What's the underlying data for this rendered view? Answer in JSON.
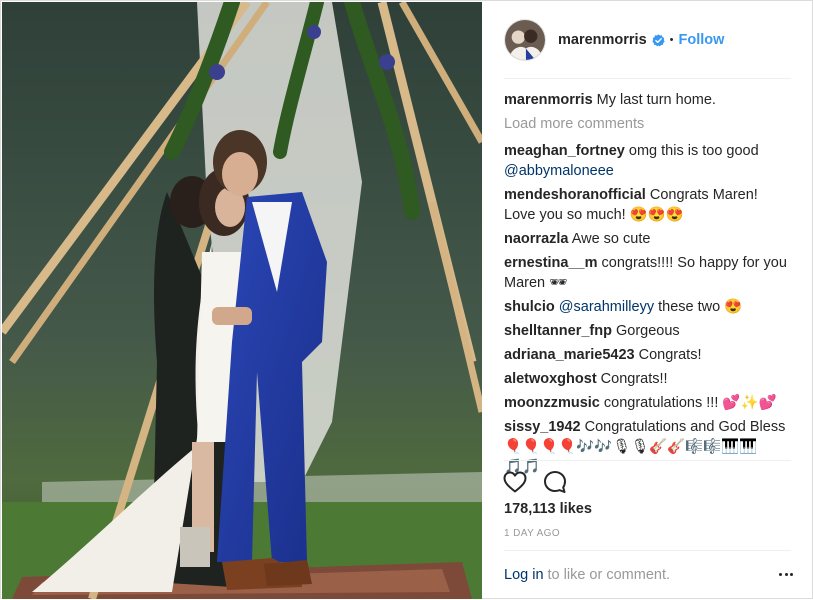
{
  "post": {
    "owner": "marenmorris",
    "follow_label": "Follow",
    "dot": "•",
    "caption": {
      "user": "marenmorris",
      "text": " My last turn home."
    },
    "load_more": "Load more comments",
    "comments": [
      {
        "user": "meaghan_fortney",
        "text": " omg this is too good ",
        "mention": "@abbymaloneee",
        "after": ""
      },
      {
        "user": "mendeshoranofficial",
        "text": " Congrats Maren! Love you so much! 😍😍😍",
        "mention": "",
        "after": ""
      },
      {
        "user": "naorrazla",
        "text": " Awe so cute",
        "mention": "",
        "after": ""
      },
      {
        "user": "ernestina__m",
        "text": " congrats!!!! So happy for you Maren 🕶",
        "mention": "",
        "after": ""
      },
      {
        "user": "shulcio",
        "text": " ",
        "mention": "@sarahmilleyy",
        "after": " these two 😍"
      },
      {
        "user": "shelltanner_fnp",
        "text": " Gorgeous",
        "mention": "",
        "after": ""
      },
      {
        "user": "adriana_marie5423",
        "text": " Congrats!",
        "mention": "",
        "after": ""
      },
      {
        "user": "aletwoxghost",
        "text": " Congrats!!",
        "mention": "",
        "after": ""
      },
      {
        "user": "moonzzmusic",
        "text": " congratulations !!! 💕✨💕",
        "mention": "",
        "after": ""
      },
      {
        "user": "sissy_1942",
        "text": " Congratulations and God Bless 🎈🎈🎈🎈🎶🎶🎙🎙🎸🎸🎼🎼🎹🎹🎵🎵",
        "mention": "",
        "after": ""
      }
    ],
    "likes": "178,113 likes",
    "timestamp": "1 DAY AGO",
    "footer": {
      "login": "Log in",
      "rest": "to like or comment."
    }
  },
  "icons": {
    "verified": "verified-badge-icon",
    "like": "heart-icon",
    "comment": "comment-bubble-icon",
    "more": "more-options-icon"
  },
  "colors": {
    "accent": "#3897f0",
    "link": "#003569",
    "muted": "#999999",
    "text": "#262626"
  }
}
